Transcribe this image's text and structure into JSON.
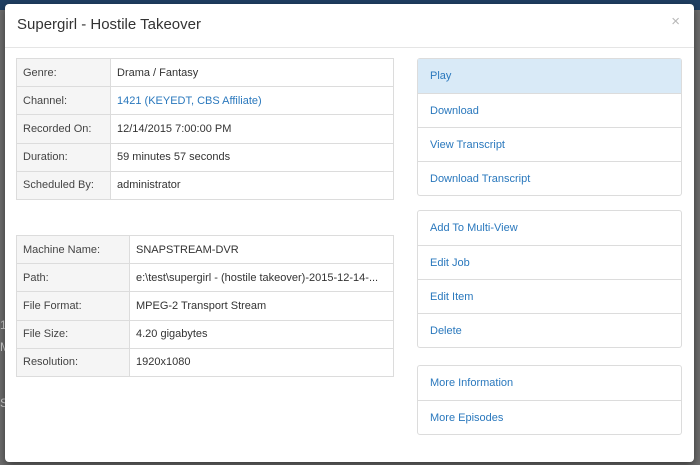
{
  "modal": {
    "title": "Supergirl - Hostile Takeover",
    "close_glyph": "×"
  },
  "recording_details": [
    {
      "label": "Genre:",
      "value": "Drama / Fantasy"
    },
    {
      "label": "Channel:",
      "value": "1421 (KEYEDT, CBS Affiliate)"
    },
    {
      "label": "Recorded On:",
      "value": "12/14/2015 7:00:00 PM"
    },
    {
      "label": "Duration:",
      "value": "59 minutes 57 seconds"
    },
    {
      "label": "Scheduled By:",
      "value": "administrator"
    }
  ],
  "file_details": [
    {
      "label": "Machine Name:",
      "value": "SNAPSTREAM-DVR"
    },
    {
      "label": "Path:",
      "value": "e:\\test\\supergirl - (hostile takeover)-2015-12-14-..."
    },
    {
      "label": "File Format:",
      "value": "MPEG-2 Transport Stream"
    },
    {
      "label": "File Size:",
      "value": "4.20 gigabytes"
    },
    {
      "label": "Resolution:",
      "value": "1920x1080"
    }
  ],
  "actions": {
    "primary": [
      "Play",
      "Download",
      "View Transcript",
      "Download Transcript"
    ],
    "manage": [
      "Add To Multi-View",
      "Edit Job",
      "Edit Item",
      "Delete"
    ],
    "more": [
      "More Information",
      "More Episodes"
    ]
  },
  "colors": {
    "link": "#2a78bd",
    "active_bg": "#d9eaf7",
    "overlay": "#6e6e6e"
  }
}
